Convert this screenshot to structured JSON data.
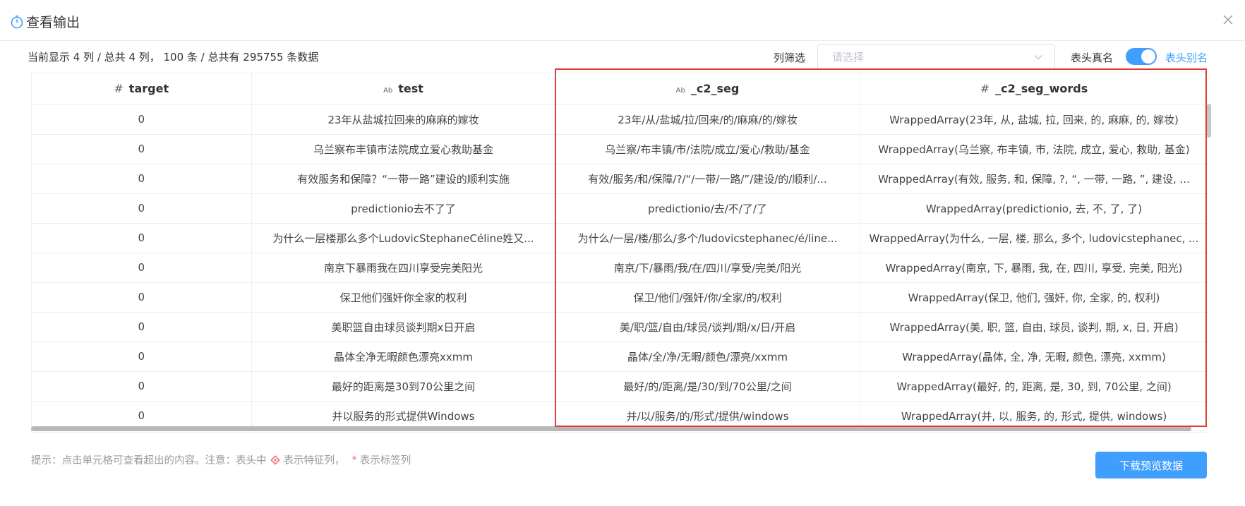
{
  "dialog": {
    "title": "查看输出"
  },
  "summary": "当前显示 4 列 / 总共 4 列， 100 条 / 总共有 295755 条数据",
  "filter": {
    "label": "列筛选",
    "placeholder": "请选择"
  },
  "toggle": {
    "left_label": "表头真名",
    "right_label": "表头别名",
    "on": true
  },
  "table": {
    "columns": [
      {
        "type_icon": "#",
        "name": "target"
      },
      {
        "type_icon": "Ab",
        "name": "test"
      },
      {
        "type_icon": "Ab",
        "name": "_c2_seg"
      },
      {
        "type_icon": "#",
        "name": "_c2_seg_words"
      }
    ],
    "rows": [
      [
        "0",
        "23年从盐城拉回来的麻麻的嫁妆",
        "23年/从/盐城/拉/回来/的/麻麻/的/嫁妆",
        "WrappedArray(23年, 从, 盐城, 拉, 回来, 的, 麻麻, 的, 嫁妆)"
      ],
      [
        "0",
        "乌兰察布丰镇市法院成立爱心救助基金",
        "乌兰察/布丰镇/市/法院/成立/爱心/救助/基金",
        "WrappedArray(乌兰察, 布丰镇, 市, 法院, 成立, 爱心, 救助, 基金)"
      ],
      [
        "0",
        "有效服务和保障？“一带一路”建设的顺利实施",
        "有效/服务/和/保障/?/“/一带/一路/”/建设/的/顺利/...",
        "WrappedArray(有效, 服务, 和, 保障, ?, “, 一带, 一路, ”, 建设, ..."
      ],
      [
        "0",
        "predictionio去不了了",
        "predictionio/去/不/了/了",
        "WrappedArray(predictionio, 去, 不, 了, 了)"
      ],
      [
        "0",
        "为什么一层楼那么多个LudovicStephaneCéline姓又...",
        "为什么/一层/楼/那么/多个/ludovicstephanec/é/line...",
        "WrappedArray(为什么, 一层, 楼, 那么, 多个, ludovicstephanec, ..."
      ],
      [
        "0",
        "南京下暴雨我在四川享受完美阳光",
        "南京/下/暴雨/我/在/四川/享受/完美/阳光",
        "WrappedArray(南京, 下, 暴雨, 我, 在, 四川, 享受, 完美, 阳光)"
      ],
      [
        "0",
        "保卫他们强奸你全家的权利",
        "保卫/他们/强奸/你/全家/的/权利",
        "WrappedArray(保卫, 他们, 强奸, 你, 全家, 的, 权利)"
      ],
      [
        "0",
        "美职篮自由球员谈判期x日开启",
        "美/职/篮/自由/球员/谈判/期/x/日/开启",
        "WrappedArray(美, 职, 篮, 自由, 球员, 谈判, 期, x, 日, 开启)"
      ],
      [
        "0",
        "晶体全净无暇颜色漂亮xxmm",
        "晶体/全/净/无暇/颜色/漂亮/xxmm",
        "WrappedArray(晶体, 全, 净, 无暇, 颜色, 漂亮, xxmm)"
      ],
      [
        "0",
        "最好的距离是30到70公里之间",
        "最好/的/距离/是/30/到/70公里/之间",
        "WrappedArray(最好, 的, 距离, 是, 30, 到, 70公里, 之间)"
      ],
      [
        "0",
        "并以服务的形式提供Windows",
        "并/以/服务/的/形式/提供/windows",
        "WrappedArray(并, 以, 服务, 的, 形式, 提供, windows)"
      ]
    ]
  },
  "hint": {
    "prefix": "提示：点击单元格可查看超出的内容。注意：表头中",
    "feature_text": "表示特征列，",
    "star": "*",
    "label_text": "表示标签列"
  },
  "download_button": "下载预览数据",
  "colors": {
    "primary": "#409eff",
    "highlight": "#e53935"
  },
  "icons": [
    "timer-icon",
    "close-icon",
    "chevron-down-icon",
    "number-type-icon",
    "text-type-icon",
    "feature-column-icon"
  ]
}
